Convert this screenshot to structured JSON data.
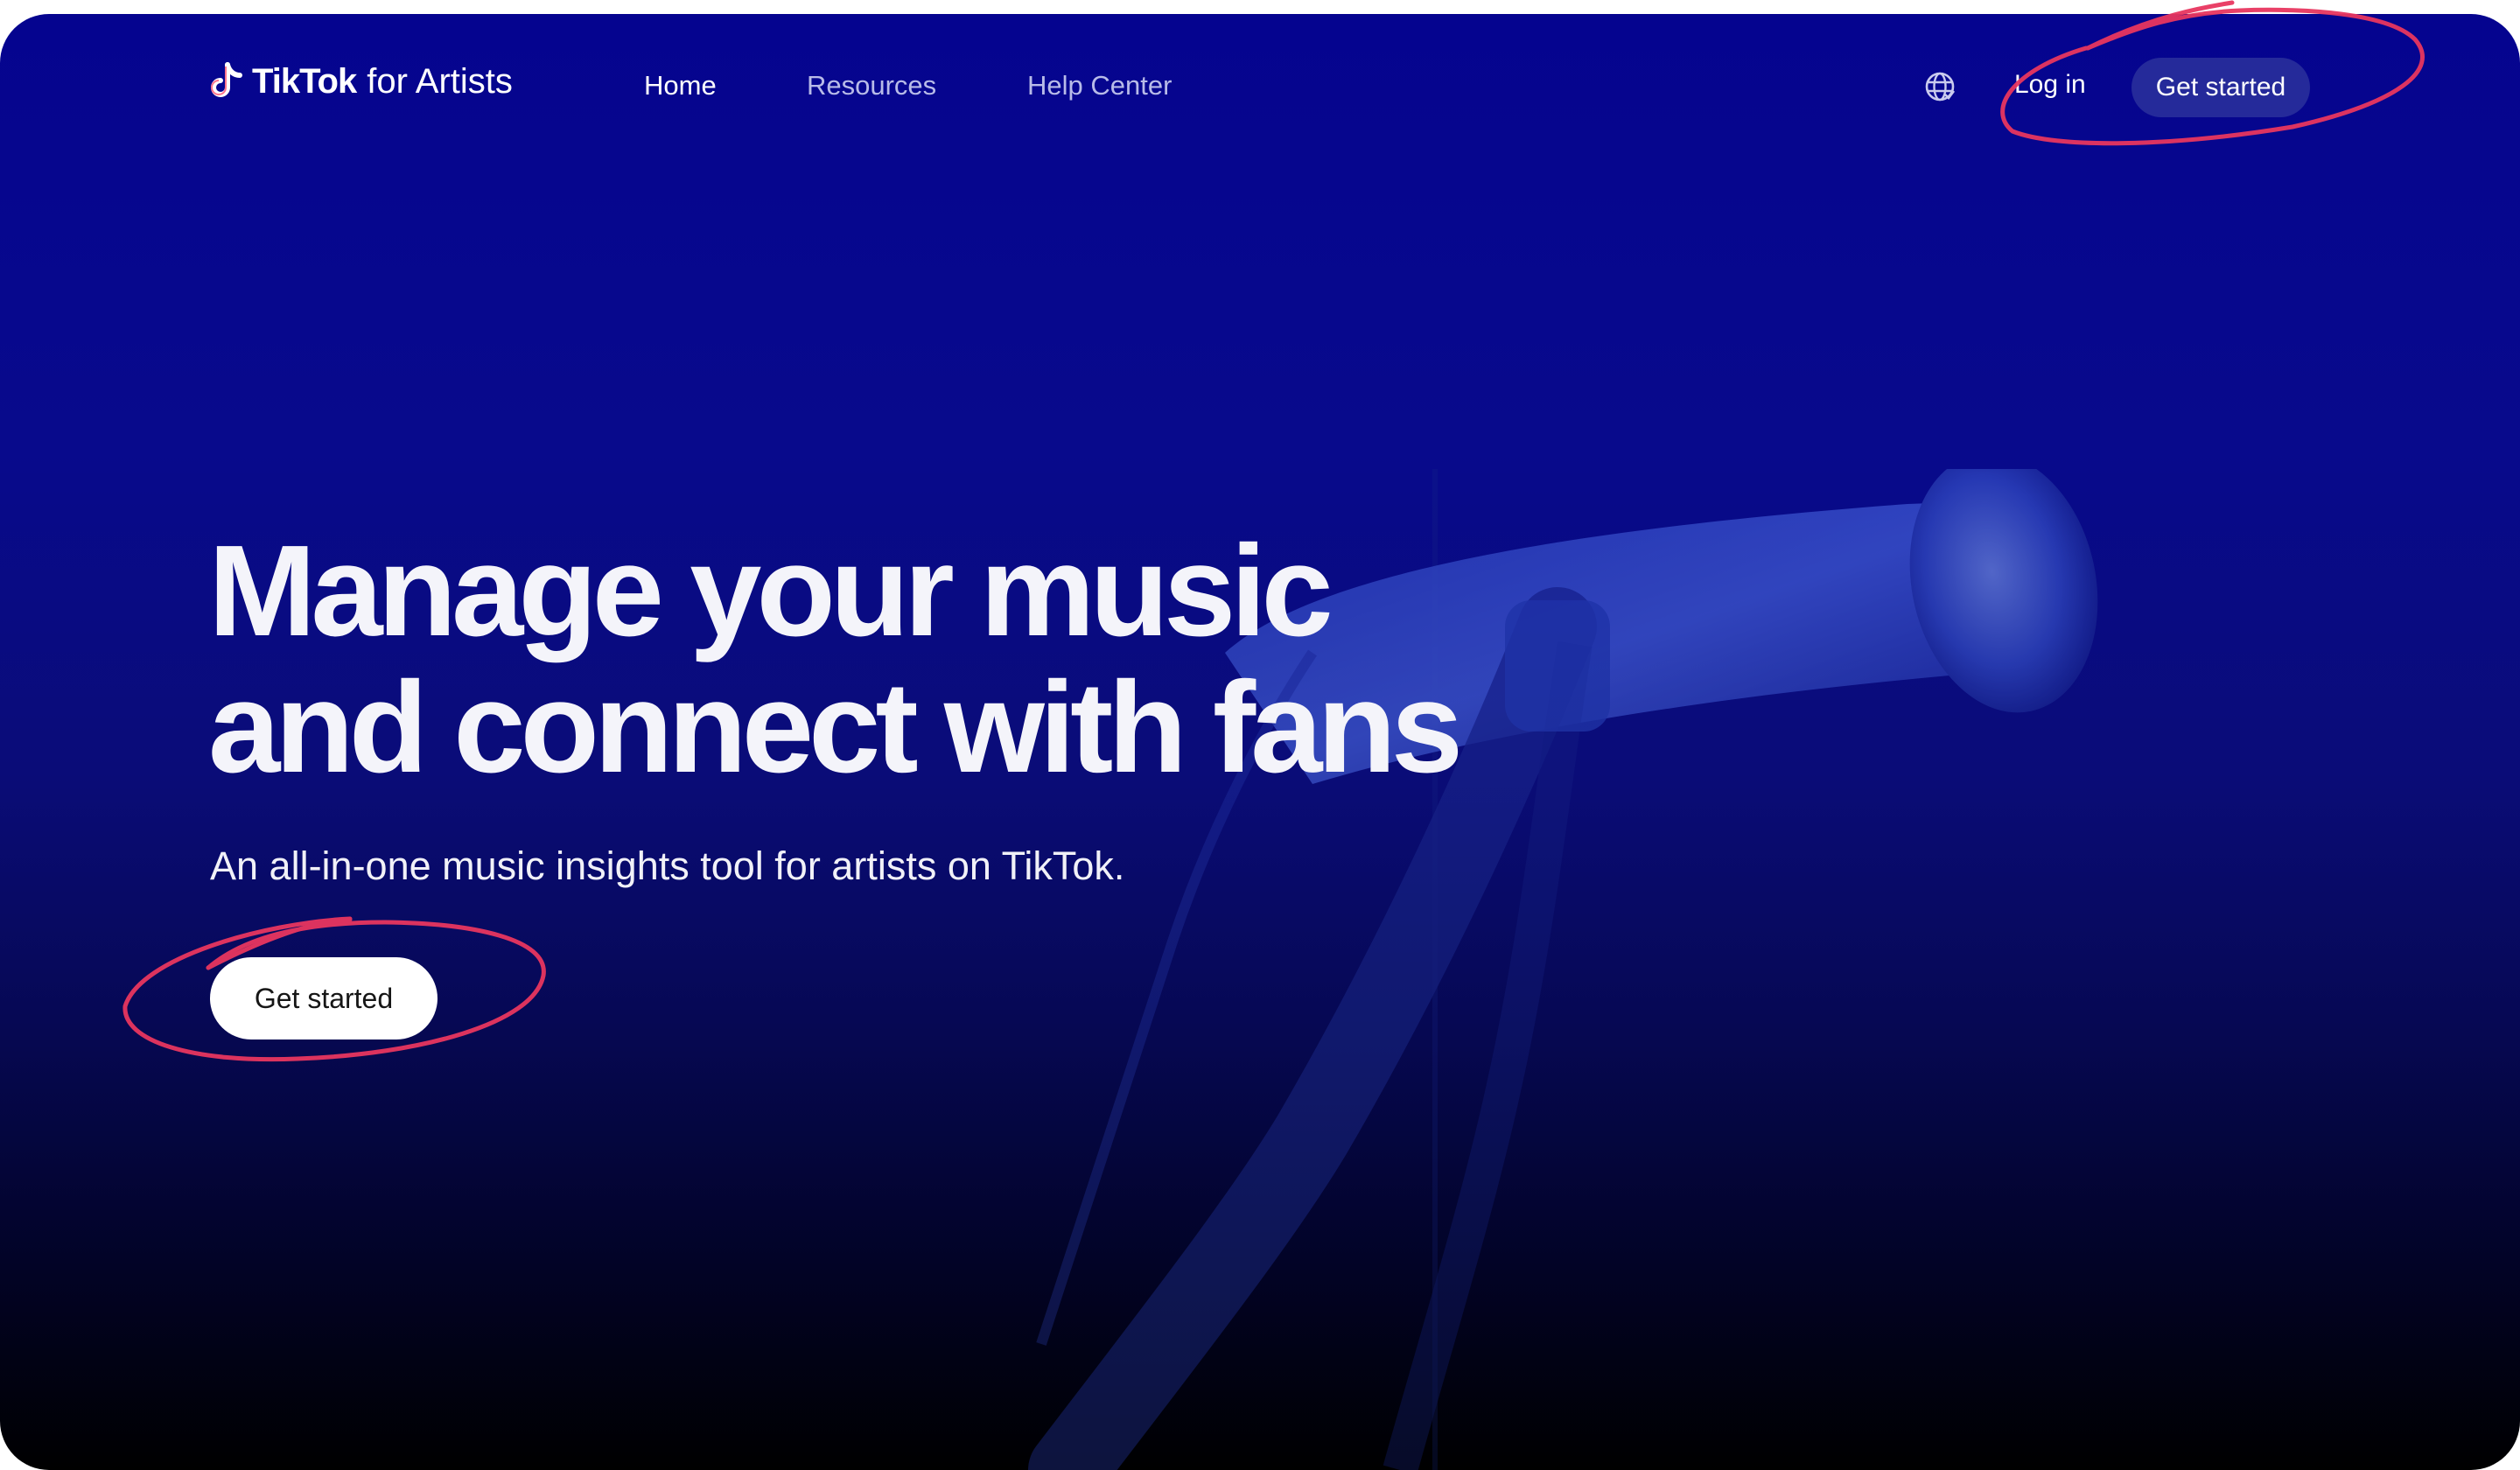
{
  "nav": {
    "brand": "TikTok",
    "brand_suffix": "for Artists",
    "links": [
      {
        "label": "Home",
        "active": true
      },
      {
        "label": "Resources",
        "active": false
      },
      {
        "label": "Help Center",
        "active": false
      }
    ],
    "language_icon": "globe-icon",
    "login_label": "Log in",
    "cta_label": "Get started"
  },
  "hero": {
    "title_line1": "Manage your music",
    "title_line2": "and connect with fans",
    "subtitle": "An all-in-one music insights tool for artists on TikTok.",
    "cta_label": "Get started"
  },
  "colors": {
    "background_top": "#05048f",
    "background_bottom": "#000000",
    "annotation": "#e8365f",
    "hero_button": "#ffffff",
    "nav_button": "#252a9a"
  }
}
